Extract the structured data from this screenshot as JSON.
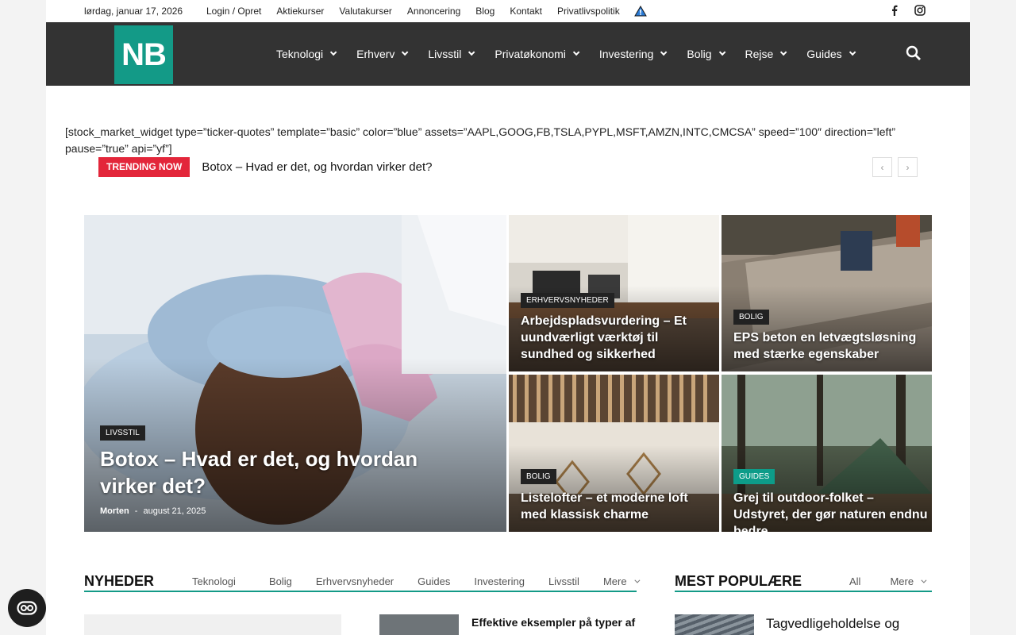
{
  "topbar": {
    "date": "lørdag, januar 17, 2026",
    "links": [
      "Login / Opret",
      "Aktiekurser",
      "Valutakurser",
      "Annoncering",
      "Blog",
      "Kontakt",
      "Privatlivspolitik"
    ],
    "social": [
      "facebook-icon",
      "instagram-icon"
    ]
  },
  "header": {
    "logo_text": "NB",
    "nav": [
      "Teknologi",
      "Erhverv",
      "Livsstil",
      "Privatøkonomi",
      "Investering",
      "Bolig",
      "Rejse",
      "Guides"
    ],
    "colors": {
      "header_bg": "#333333",
      "logo_bg": "#139a87"
    }
  },
  "shortcode": "[stock_market_widget type=”ticker-quotes” template=”basic” color=”blue” assets=”AAPL,GOOG,FB,TSLA,PYPL,MSFT,AMZN,INTC,CMCSA” speed=”100″ direction=”left” pause=”true” api=”yf”]",
  "trending": {
    "badge": "TRENDING NOW",
    "title": "Botox – Hvad er det, og hvordan virker det?",
    "prev": "‹",
    "next": "›"
  },
  "featured": {
    "main": {
      "category": "LIVSSTIL",
      "title": "Botox – Hvad er det, og hvordan virker det?",
      "author": "Morten",
      "sep": "-",
      "date": "august 21, 2025"
    },
    "t1": {
      "category": "ERHVERVSNYHEDER",
      "title": "Arbejdspladsvurdering – Et uundværligt værktøj til sundhed og sikkerhed"
    },
    "t2": {
      "category": "BOLIG",
      "title": "EPS beton en letvægtsløsning med stærke egenskaber"
    },
    "t3": {
      "category": "BOLIG",
      "title": "Listelofter – et moderne loft med klassisk charme"
    },
    "t4": {
      "category": "GUIDES",
      "title": "Grej til outdoor-folket – Udstyret, der gør naturen endnu bedre"
    }
  },
  "news": {
    "heading": "NYHEDER",
    "tabs": [
      "Teknologi",
      "Bolig",
      "Erhvervsnyheder",
      "Guides",
      "Investering",
      "Livsstil"
    ],
    "more": "Mere",
    "item_title": "Effektive eksempler på typer af"
  },
  "popular": {
    "heading": "MEST POPULÆRE",
    "tabs": [
      "All"
    ],
    "more": "Mere",
    "item_title": "Tagvedligeholdelse og"
  }
}
